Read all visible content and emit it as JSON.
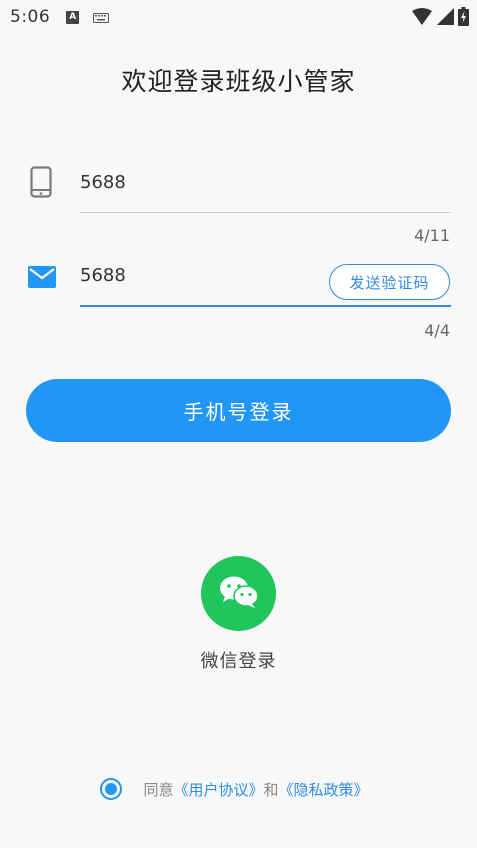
{
  "status_bar": {
    "time": "5:06",
    "icons": [
      "a-notification-icon",
      "keyboard-icon",
      "wifi-icon",
      "signal-icon",
      "battery-charging-icon"
    ]
  },
  "title": "欢迎登录班级小管家",
  "phone_field": {
    "value": "5688",
    "counter": "4/11",
    "icon": "phone-icon"
  },
  "code_field": {
    "value": "5688",
    "counter": "4/4",
    "icon": "mail-icon",
    "send_code_label": "发送验证码"
  },
  "login_button": {
    "label": "手机号登录"
  },
  "wechat": {
    "label": "微信登录",
    "icon": "wechat-icon"
  },
  "agreement": {
    "prefix": "同意",
    "user_agreement": "《用户协议》",
    "and": "和",
    "privacy_policy": "《隐私政策》",
    "checked": true
  },
  "colors": {
    "primary": "#2196f7",
    "link": "#2d8de9",
    "wechat": "#20c65c",
    "background": "#f8f8f8"
  }
}
